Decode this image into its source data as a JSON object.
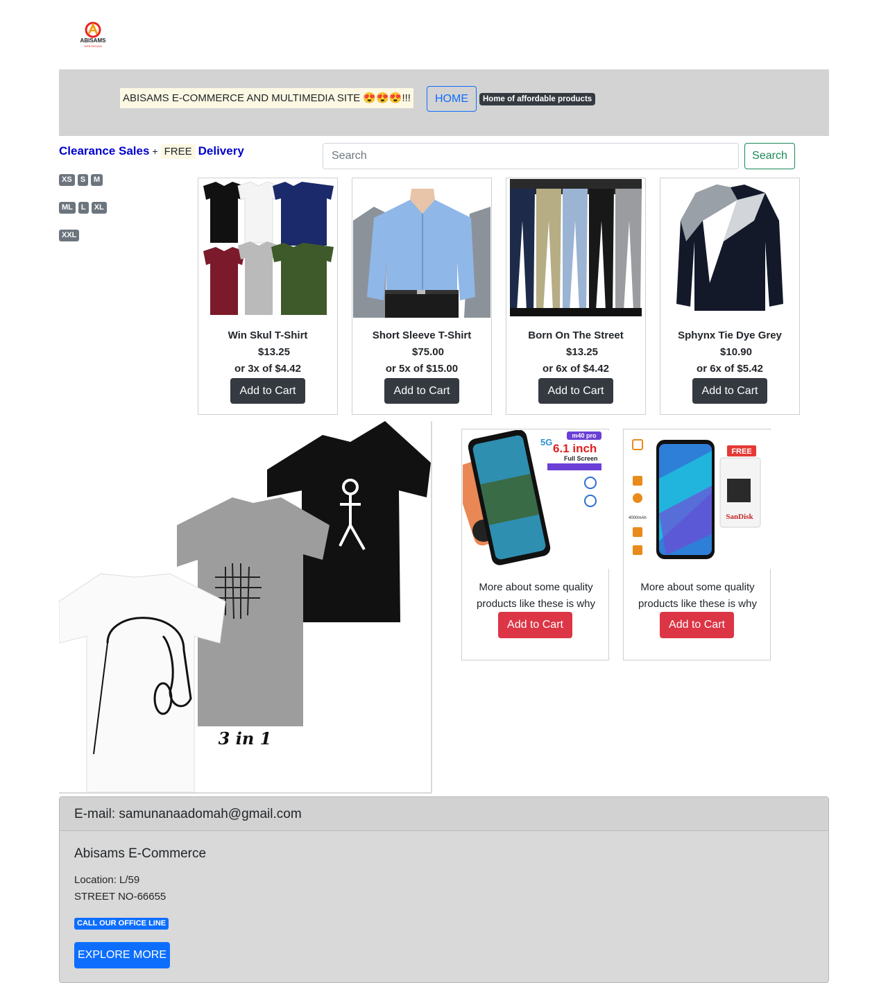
{
  "logo": {
    "brand": "ABISAMS",
    "tagline": "WEB DESIGN"
  },
  "navbar": {
    "site_title": "ABISAMS E-COMMERCE AND MULTIMEDIA SITE 😍😍😍!!!",
    "home_label": "HOME",
    "badge": "Home of affordable products"
  },
  "promo": {
    "clearance": "Clearance Sales",
    "plus": "+",
    "free": "FREE",
    "delivery": "Delivery"
  },
  "sizes": {
    "row1": [
      "XS",
      "S",
      "M"
    ],
    "row2": [
      "ML",
      "L",
      "XL"
    ],
    "row3": [
      "XXL"
    ]
  },
  "search": {
    "placeholder": "Search",
    "button_label": "Search"
  },
  "products": [
    {
      "name": "Win Skul T-Shirt",
      "price": "$13.25",
      "installment": "or 3x of $4.42",
      "button": "Add to Cart"
    },
    {
      "name": "Short Sleeve T-Shirt",
      "price": "$75.00",
      "installment": "or 5x of $15.00",
      "button": "Add to Cart"
    },
    {
      "name": "Born On The Street",
      "price": "$13.25",
      "installment": "or 6x of $4.42",
      "button": "Add to Cart"
    },
    {
      "name": "Sphynx Tie Dye Grey",
      "price": "$10.90",
      "installment": "or 6x of $5.42",
      "button": "Add to Cart"
    }
  ],
  "hero": {
    "caption": "3 in 1"
  },
  "promo_cards": [
    {
      "desc": "More about some quality products like these is why",
      "button": "Add to Cart",
      "img_text_1": "6.1 inch",
      "img_text_2": "Full Screen",
      "img_text_3": "m40 pro",
      "img_text_4": "5G"
    },
    {
      "desc": "More about some quality products like these is why",
      "button": "Add to Cart",
      "img_text_1": "FREE",
      "img_text_2": "SanDisk",
      "img_text_3": "4000mAh"
    }
  ],
  "footer": {
    "email": "E-mail: samunanaadomah@gmail.com",
    "company": "Abisams E-Commerce",
    "location_line1": "Location: L/59",
    "location_line2": "STREET NO-66655",
    "call_badge": "CALL OUR OFFICE LINE",
    "explore_label": "EXPLORE MORE"
  },
  "colors": {
    "navbar_bg": "#d3d3d3",
    "promo_blue": "#0000cd",
    "primary": "#0d6efd",
    "success": "#198754",
    "danger": "#dc3545",
    "dark": "#343a40",
    "secondary": "#6c757d"
  }
}
